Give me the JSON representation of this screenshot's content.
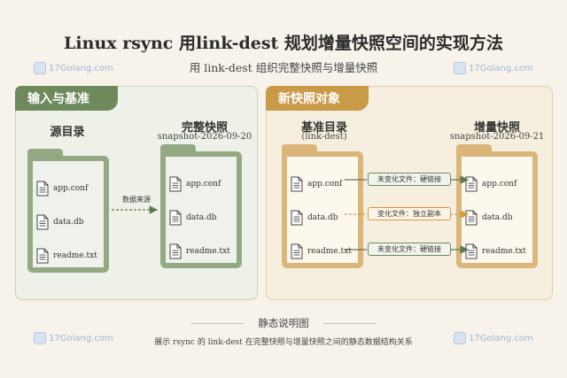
{
  "header": {
    "title": "Linux rsync 用link-dest 规划增量快照空间的实现方法",
    "subtitle": "用 link-dest 组织完整快照与增量快照"
  },
  "watermark": {
    "text": "17Golang.com"
  },
  "left_panel": {
    "tab": "输入与基准",
    "source": {
      "title": "源目录",
      "files": [
        "app.conf",
        "data.db",
        "readme.txt"
      ]
    },
    "full": {
      "title": "完整快照",
      "sub": "snapshot-2026-09-20",
      "files": [
        "app.conf",
        "data.db",
        "readme.txt"
      ]
    },
    "arrow_label": "数据来源"
  },
  "right_panel": {
    "tab": "新快照对象",
    "base": {
      "title": "基准目录",
      "sub": "(link-dest)",
      "files": [
        "app.conf",
        "data.db",
        "readme.txt"
      ]
    },
    "incr": {
      "title": "增量快照",
      "sub": "snapshot-2026-09-21",
      "files": [
        "app.conf",
        "data.db",
        "readme.txt"
      ]
    },
    "links": [
      "未变化文件：硬链接",
      "变化文件：独立副本",
      "未变化文件：硬链接"
    ]
  },
  "legend": {
    "title": "静态说明图",
    "desc": "展示 rsync 的 link-dest 在完整快照与增量快照之间的静态数据结构关系"
  },
  "colors": {
    "green": "#6e8a5c",
    "gold": "#c99b49",
    "orange": "#d39a3e",
    "background": "#f7f3ea"
  }
}
